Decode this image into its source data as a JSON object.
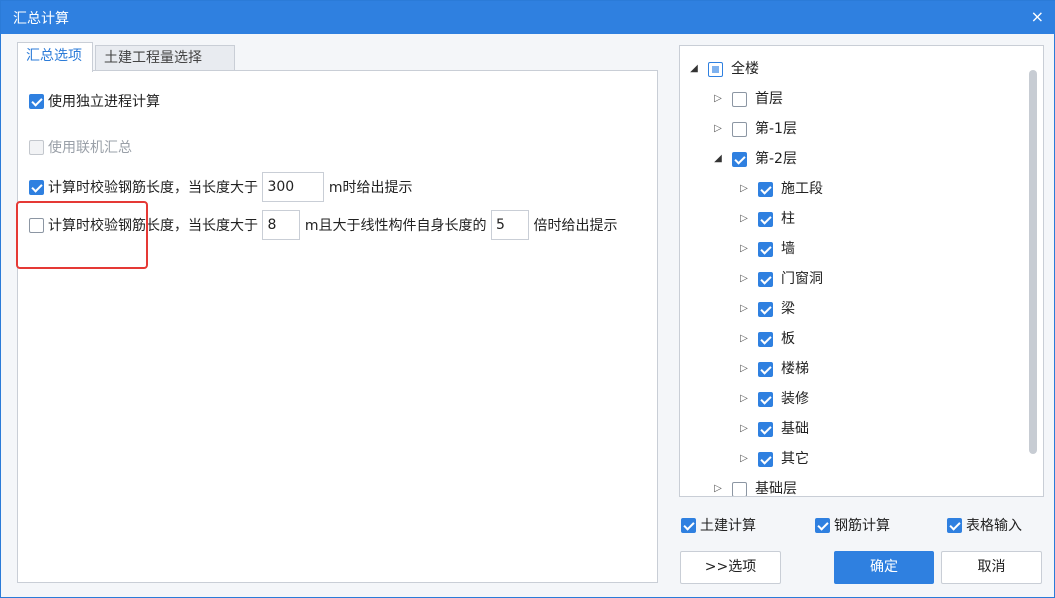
{
  "window": {
    "title": "汇总计算",
    "close_glyph": "×"
  },
  "tabs": [
    {
      "label": "汇总选项",
      "active": true
    },
    {
      "label": "土建工程量选择",
      "active": false
    }
  ],
  "options": {
    "use_independent_process": {
      "label": "使用独立进程计算",
      "checked": true
    },
    "use_network_summary": {
      "label": "使用联机汇总",
      "checked": false,
      "disabled": true
    },
    "check_rebar_length": {
      "checked": true,
      "prefix": "计算时校验钢筋长度，当长度大于",
      "value": "300",
      "suffix": "m时给出提示"
    },
    "check_rebar_length_linear": {
      "checked": false,
      "prefix": "计算时校验钢筋长度，当长度大于",
      "value1": "8",
      "middle": "m且大于线性构件自身长度的",
      "value2": "5",
      "suffix": "倍时给出提示"
    }
  },
  "tree": {
    "root": {
      "label": "全楼",
      "state": "partial",
      "expanded": true
    },
    "floors": [
      {
        "label": "首层",
        "checked": false,
        "expanded": false
      },
      {
        "label": "第-1层",
        "checked": false,
        "expanded": false
      },
      {
        "label": "第-2层",
        "checked": true,
        "expanded": true,
        "children": [
          {
            "label": "施工段",
            "checked": true
          },
          {
            "label": "柱",
            "checked": true
          },
          {
            "label": "墙",
            "checked": true
          },
          {
            "label": "门窗洞",
            "checked": true
          },
          {
            "label": "梁",
            "checked": true
          },
          {
            "label": "板",
            "checked": true
          },
          {
            "label": "楼梯",
            "checked": true
          },
          {
            "label": "装修",
            "checked": true
          },
          {
            "label": "基础",
            "checked": true
          },
          {
            "label": "其它",
            "checked": true
          }
        ]
      },
      {
        "label": "基础层",
        "checked": false,
        "expanded": false
      }
    ],
    "arrows": {
      "expanded": "◢",
      "collapsed": "▷"
    }
  },
  "calc_types": [
    {
      "label": "土建计算",
      "checked": true
    },
    {
      "label": "钢筋计算",
      "checked": true
    },
    {
      "label": "表格输入",
      "checked": true
    }
  ],
  "buttons": {
    "options": ">>选项",
    "ok": "确定",
    "cancel": "取消"
  },
  "colors": {
    "accent": "#2f80e0",
    "highlight": "#e53935"
  }
}
